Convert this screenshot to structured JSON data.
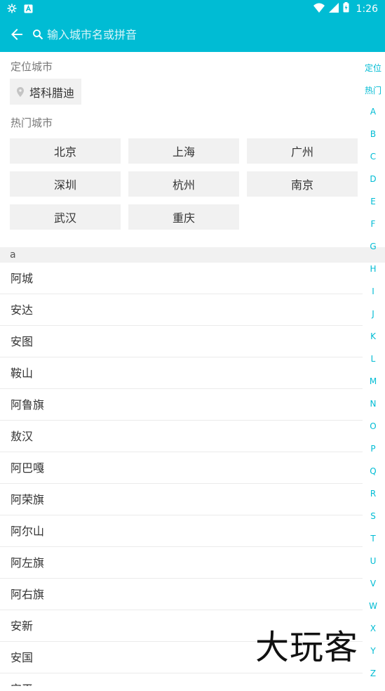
{
  "status_bar": {
    "time": "1:26",
    "icons": [
      "settings-gear-icon",
      "notification-a-icon",
      "wifi-icon",
      "signal-icon",
      "battery-icon"
    ]
  },
  "app_bar": {
    "back_icon": "arrow-left-icon",
    "search_icon": "search-icon",
    "search_placeholder": "输入城市名或拼音"
  },
  "location": {
    "title": "定位城市",
    "city": "塔科腊迪",
    "icon": "location-pin-icon"
  },
  "hot": {
    "title": "热门城市",
    "cities": [
      "北京",
      "上海",
      "广州",
      "深圳",
      "杭州",
      "南京",
      "武汉",
      "重庆"
    ]
  },
  "group": {
    "letter": "a",
    "cities": [
      "阿城",
      "安达",
      "安图",
      "鞍山",
      "阿鲁旗",
      "敖汉",
      "阿巴嘎",
      "阿荣旗",
      "阿尔山",
      "阿左旗",
      "阿右旗",
      "安新",
      "安国",
      "安平"
    ]
  },
  "index_bar": [
    "定位",
    "热门",
    "A",
    "B",
    "C",
    "D",
    "E",
    "F",
    "G",
    "H",
    "I",
    "J",
    "K",
    "L",
    "M",
    "N",
    "O",
    "P",
    "Q",
    "R",
    "S",
    "T",
    "U",
    "V",
    "W",
    "X",
    "Y",
    "Z"
  ],
  "watermark": "大玩客",
  "colors": {
    "primary": "#00bcd4",
    "chip_bg": "#f1f1f1",
    "text": "#333333",
    "section_text": "#777777"
  }
}
